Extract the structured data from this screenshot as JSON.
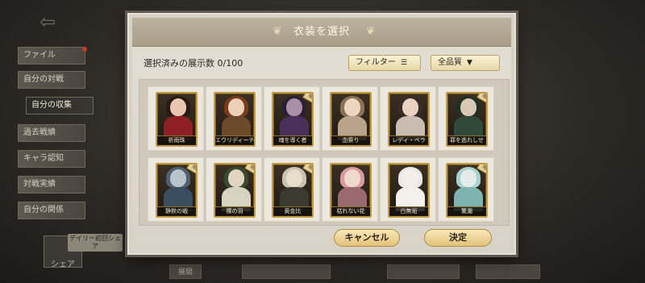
{
  "background": {
    "side_menu": [
      {
        "label": "ファイル",
        "active": false
      },
      {
        "label": "自分の対戦",
        "active": false
      },
      {
        "label": "自分の収集",
        "active": true
      },
      {
        "label": "過去戦績",
        "active": false
      },
      {
        "label": "キャラ認知",
        "active": false
      },
      {
        "label": "対戦実績",
        "active": false
      },
      {
        "label": "自分の関係",
        "active": false
      }
    ],
    "share_label": "シェア",
    "daily_tag": "デイリー初回シェア",
    "bottom_left_label": "展開"
  },
  "dialog": {
    "title": "衣装を選択",
    "counter_label": "選択済みの展示数 0/100",
    "filter_label": "フィルター",
    "filter_icon": "list-icon",
    "quality_label": "全品質",
    "quality_icon": "chevron-down-icon",
    "cancel_label": "キャンセル",
    "confirm_label": "決定",
    "ribbon_label": "限定",
    "costumes": [
      {
        "name": "祈雨珠",
        "limited": false,
        "hair": "#2a1a14",
        "skin": "#e8c6b0",
        "body": "#8e1f22"
      },
      {
        "name": "エウリディーチェ",
        "limited": false,
        "hair": "#7a3a1e",
        "skin": "#ecd0b8",
        "body": "#6a4a2a"
      },
      {
        "name": "魂を導く者",
        "limited": true,
        "hair": "#2a2035",
        "skin": "#a98fa8",
        "body": "#4a2f5a"
      },
      {
        "name": "血祭り",
        "limited": false,
        "hair": "#8a7258",
        "skin": "#ecd6c0",
        "body": "#b9a48a"
      },
      {
        "name": "レディ・ベラ",
        "limited": false,
        "hair": "#3a2c26",
        "skin": "#e9d2c2",
        "body": "#cbbcb1"
      },
      {
        "name": "罪を逃れしせ",
        "limited": true,
        "hair": "#203024",
        "skin": "#d8c8b4",
        "body": "#2f4a38"
      },
      {
        "name": "静默の戦",
        "limited": true,
        "hair": "#506070",
        "skin": "#b8c4cc",
        "body": "#3a4e60"
      },
      {
        "name": "檬の羽",
        "limited": true,
        "hair": "#3a4a30",
        "skin": "#e3d4c0",
        "body": "#d8d2c0"
      },
      {
        "name": "黄金比",
        "limited": true,
        "hair": "#c9c2b2",
        "skin": "#e8dccb",
        "body": "#3a3a30"
      },
      {
        "name": "枯れない花",
        "limited": false,
        "hair": "#d89aa0",
        "skin": "#efd8cc",
        "body": "#9a6a6e"
      },
      {
        "name": "白無垢",
        "limited": false,
        "hair": "#e9e9ea",
        "skin": "#f3eeea",
        "body": "#f4f1ec"
      },
      {
        "name": "驚瀾",
        "limited": true,
        "hair": "#a8d2d0",
        "skin": "#e3ece8",
        "body": "#7fb3b0"
      }
    ]
  }
}
